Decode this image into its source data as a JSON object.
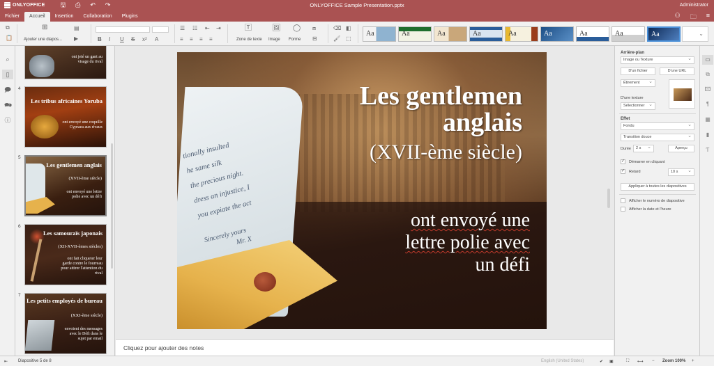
{
  "app": {
    "brand": "ONLYOFFICE",
    "document_title": "ONLYOFFICE Sample Presentation.pptx",
    "user": "Administrator"
  },
  "tabs": [
    {
      "label": "Fichier"
    },
    {
      "label": "Accueil"
    },
    {
      "label": "Insertion"
    },
    {
      "label": "Collaboration"
    },
    {
      "label": "Plugins"
    }
  ],
  "toolbar": {
    "add_slide_label": "Ajouter une diapos...",
    "text_box_label": "Zone de texte",
    "image_label": "Image",
    "shape_label": "Forme",
    "theme_label": "Aa"
  },
  "thumbnails": [
    {
      "num": "",
      "title": "",
      "body": "ont jeté un gant au visage du rival"
    },
    {
      "num": "4",
      "title": "Les tribus africaines Yoruba",
      "body": "ont envoyé une coquille Cypraea aux rivaux"
    },
    {
      "num": "5",
      "title": "Les gentlemen anglais",
      "sub": "(XVII-ème siècle)",
      "body": "ont envoyé une lettre polie avec un défi"
    },
    {
      "num": "6",
      "title": "Les samouraïs japonais",
      "sub": "(XII-XVII-èmes siècles)",
      "body": "ont fait cliqueter leur garde contre le fourreau pour attirer l'attention du rival"
    },
    {
      "num": "7",
      "title": "Les petits employés de bureau",
      "sub": "(XXI-ème siècle)",
      "body": "envoient des messages avec le Défi dans le sujet par email"
    }
  ],
  "slide": {
    "title_line1": "Les gentlemen",
    "title_line2": "anglais",
    "subtitle": "(XVII-ème siècle)",
    "body_line1": "ont envoyé une",
    "body_line2": "lettre polie avec",
    "body_line3": "un défi",
    "letter_text": "tionally insulted\nhe same silk\nthe precious night.\ndress an injustice, I\nyou expiate the act",
    "letter_sign_1": "Sincerely yours",
    "letter_sign_2": "Mr. X"
  },
  "notes_placeholder": "Cliquez pour ajouter des notes",
  "right_panel": {
    "background_heading": "Arrière-plan",
    "fill_type": "Image ou Texture",
    "from_file": "D'un fichier",
    "from_url": "D'une URL",
    "stretch": "Étirement",
    "from_texture_label": "D'une texture",
    "select_label": "Sélectionner",
    "effect_heading": "Effet",
    "effect_value": "Fondu",
    "transition_value": "Transition douce",
    "duration_label": "Durée",
    "duration_value": "2 s",
    "preview_button": "Aperçu",
    "start_on_click": "Démarrer en cliquant",
    "delay_label": "Retard",
    "delay_value": "10 s",
    "apply_all": "Appliquer à toutes les diapositives",
    "show_slide_number": "Afficher le numéro de diapositive",
    "show_date": "Afficher la date et l'heure"
  },
  "status": {
    "slide_position": "Diapositive 5 de 8",
    "language": "English (United States)",
    "zoom": "Zoom 100%"
  }
}
